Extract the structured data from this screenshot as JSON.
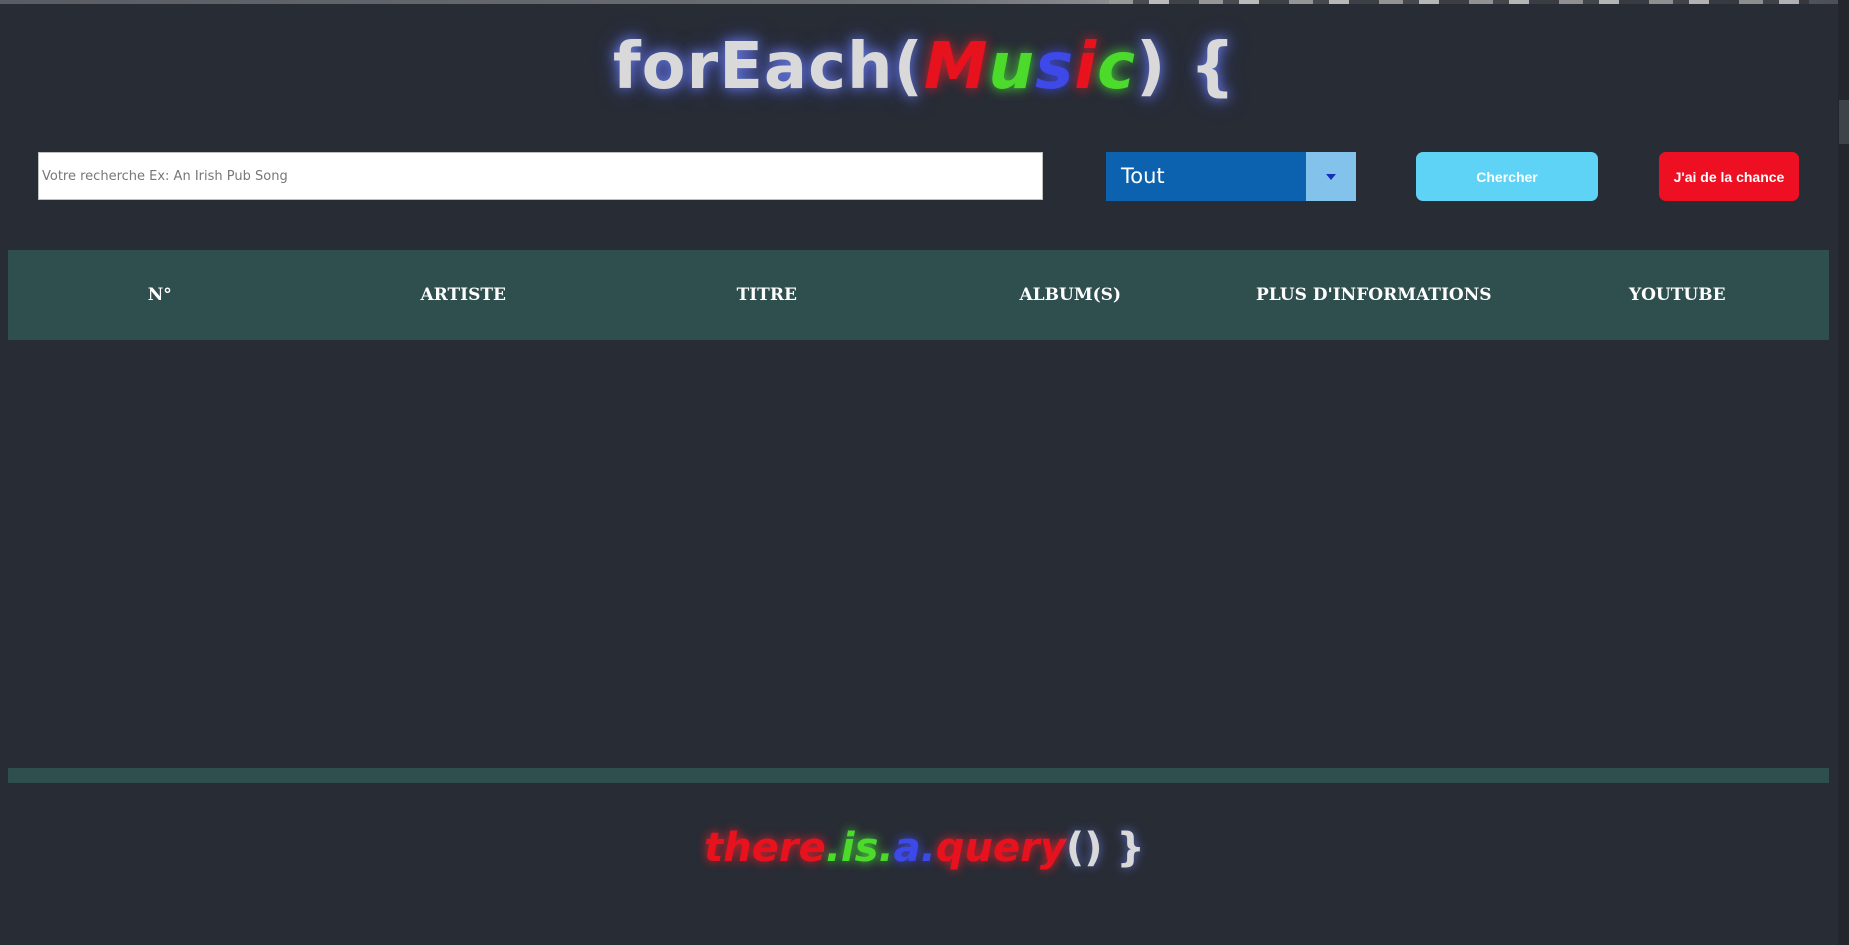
{
  "header": {
    "title_parts": {
      "prefix": "forEach(",
      "m": "M",
      "u": "u",
      "s": "s",
      "i": "i",
      "c": "c",
      "suffix": ") {"
    }
  },
  "search": {
    "placeholder": "Votre recherche Ex: An Irish Pub Song",
    "value": ""
  },
  "filter": {
    "selected": "Tout"
  },
  "buttons": {
    "search_label": "Chercher",
    "lucky_label": "J'ai de la chance"
  },
  "table": {
    "columns": [
      "N°",
      "ARTISTE",
      "TITRE",
      "ALBUM(S)",
      "PLUS D'INFORMATIONS",
      "YOUTUBE"
    ],
    "rows": []
  },
  "footer": {
    "slogan_parts": {
      "there": "there",
      "dot1": ".",
      "is": "is",
      "dot2": ".",
      "a": "a",
      "dot3": ".",
      "query": "query",
      "tail": "() }"
    }
  },
  "colors": {
    "background": "#282c35",
    "table_header_bg": "#2f4f4f",
    "select_bg": "#0d62b0",
    "search_button_bg": "#5fd3f5",
    "lucky_button_bg": "#ee0f22",
    "accent_red": "#e8121e",
    "accent_green": "#4ddb2b",
    "accent_blue": "#3d49e8"
  }
}
